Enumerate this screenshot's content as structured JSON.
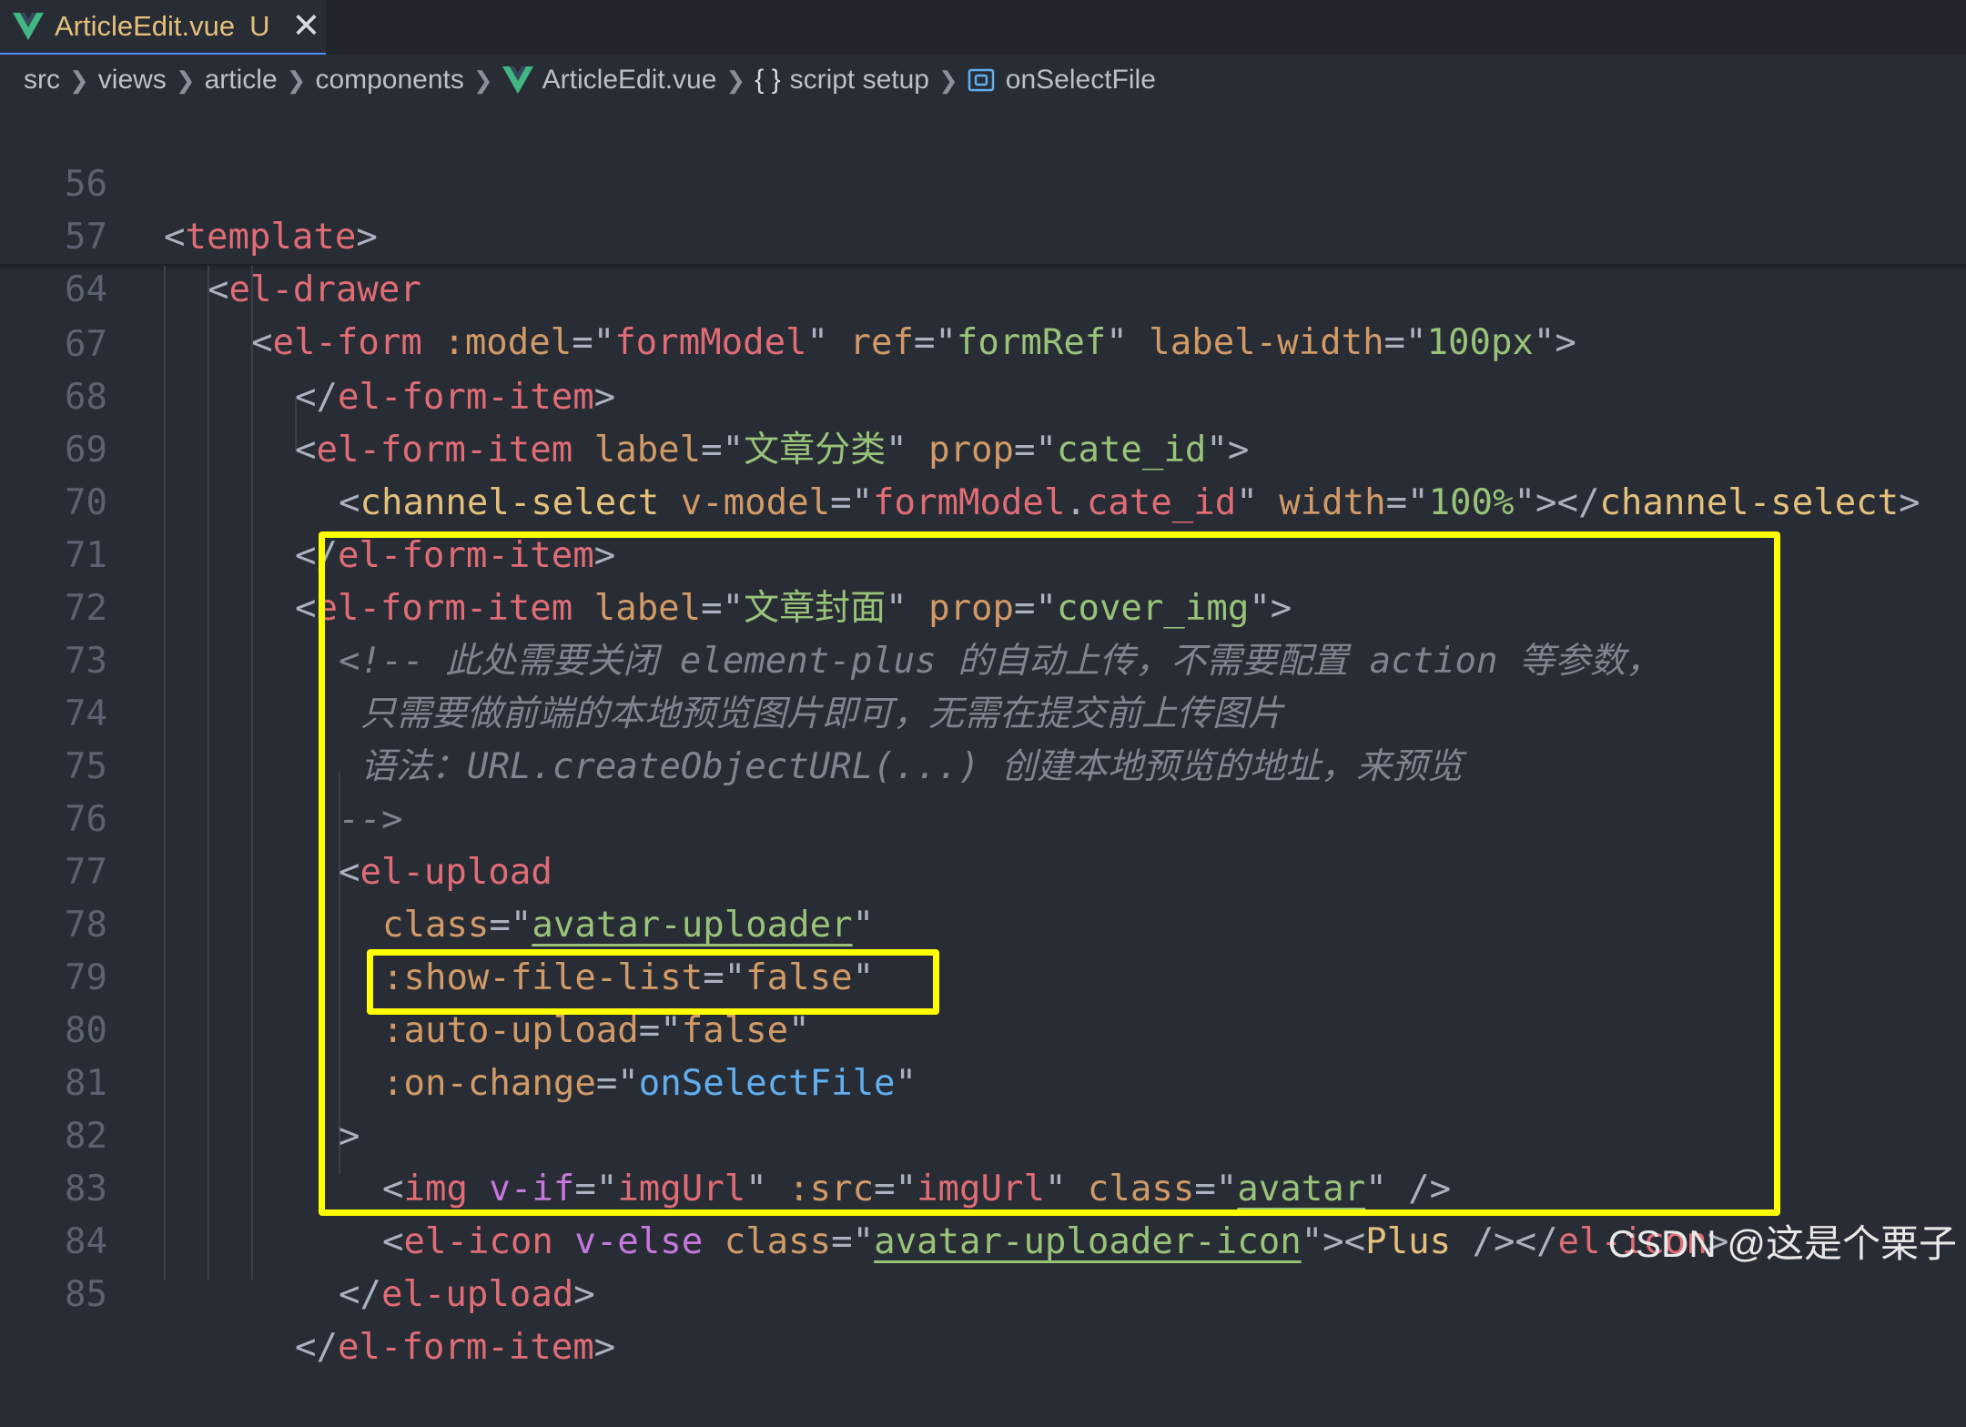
{
  "tab": {
    "title": "ArticleEdit.vue",
    "status": "U",
    "icon": "vue-icon"
  },
  "breadcrumb": {
    "parts": [
      "src",
      "views",
      "article",
      "components"
    ],
    "file": "ArticleEdit.vue",
    "brace": "{ }",
    "scope": "script setup",
    "symbol": "onSelectFile"
  },
  "sticky_lines": [
    {
      "num": "56",
      "text": "<template>"
    },
    {
      "num": "57",
      "text": "<el-drawer"
    },
    {
      "num": "64",
      "text": "<el-form :model=\"formModel\" ref=\"formRef\" label-width=\"100px\">"
    }
  ],
  "lines": [
    {
      "num": "67",
      "text": "</el-form-item>"
    },
    {
      "num": "68",
      "text": "<el-form-item label=\"文章分类\" prop=\"cate_id\">"
    },
    {
      "num": "69",
      "text": "<channel-select v-model=\"formModel.cate_id\" width=\"100%\"></channel-select>"
    },
    {
      "num": "70",
      "text": "</el-form-item>"
    },
    {
      "num": "71",
      "text": "<el-form-item label=\"文章封面\" prop=\"cover_img\">"
    },
    {
      "num": "72",
      "text": "<!-- 此处需要关闭 element-plus 的自动上传，不需要配置 action 等参数，"
    },
    {
      "num": "73",
      "text": "只需要做前端的本地预览图片即可，无需在提交前上传图片"
    },
    {
      "num": "74",
      "text": "语法：URL.createObjectURL(...) 创建本地预览的地址，来预览"
    },
    {
      "num": "75",
      "text": "-->"
    },
    {
      "num": "76",
      "text": "<el-upload"
    },
    {
      "num": "77",
      "text": "class=\"avatar-uploader\""
    },
    {
      "num": "78",
      "text": ":show-file-list=\"false\""
    },
    {
      "num": "79",
      "text": ":auto-upload=\"false\""
    },
    {
      "num": "80",
      "text": ":on-change=\"onSelectFile\""
    },
    {
      "num": "81",
      "text": ">"
    },
    {
      "num": "82",
      "text": "<img v-if=\"imgUrl\" :src=\"imgUrl\" class=\"avatar\" />"
    },
    {
      "num": "83",
      "text": "<el-icon v-else class=\"avatar-uploader-icon\"><Plus /></el-icon>"
    },
    {
      "num": "84",
      "text": "</el-upload>"
    },
    {
      "num": "85",
      "text": "</el-form-item>"
    }
  ],
  "watermark": "CSDN @这是个栗子",
  "colors": {
    "highlight": "#ffff00",
    "tag": "#e06c75",
    "attr": "#d19a66",
    "string": "#98c379",
    "comment": "#7f848e"
  }
}
